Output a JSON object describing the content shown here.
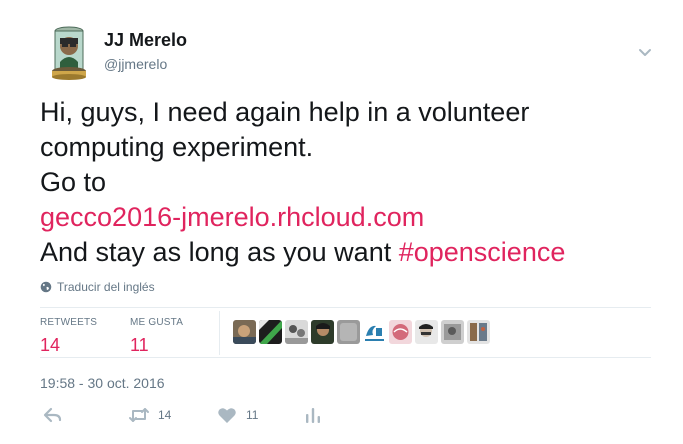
{
  "author": {
    "name": "JJ Merelo",
    "handle": "@jjmerelo"
  },
  "tweet": {
    "line1": "Hi, guys, I need again help in a volunteer",
    "line2": "computing experiment.",
    "line3": "Go to",
    "link": "gecco2016-jmerelo.rhcloud.com",
    "line5_prefix": "And stay as long as you want ",
    "hashtag": "#openscience"
  },
  "translate_label": "Traducir del inglés",
  "stats": {
    "retweets_label": "RETWEETS",
    "retweets_count": "14",
    "likes_label": "ME GUSTA",
    "likes_count": "11"
  },
  "timestamp": "19:58 - 30 oct. 2016",
  "actions": {
    "retweet_count": "14",
    "like_count": "11"
  },
  "colors": {
    "accent": "#e0245e",
    "secondary": "#657786",
    "divider": "#e6ecf0",
    "icon": "#aab8c2"
  }
}
